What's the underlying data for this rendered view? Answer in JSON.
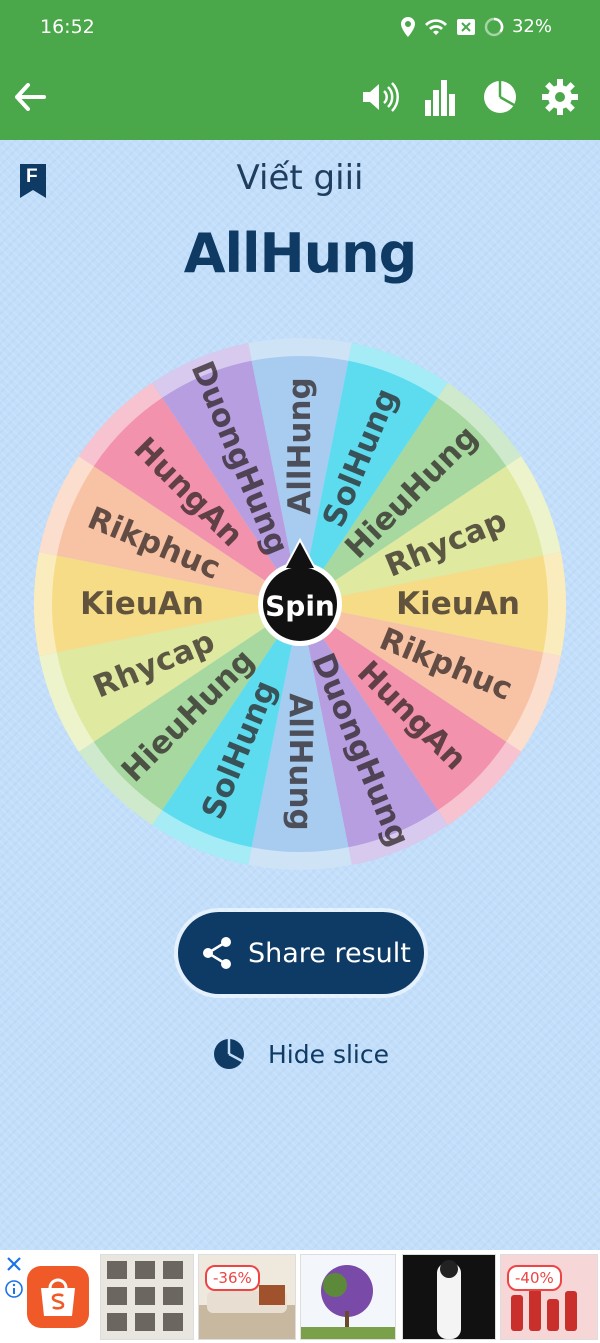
{
  "status_bar": {
    "time": "16:52",
    "battery": "32%"
  },
  "app_bar": {
    "back": "arrow-left-icon",
    "actions": [
      "speaker-icon",
      "bar-chart-icon",
      "pie-chart-icon",
      "gear-icon"
    ]
  },
  "header": {
    "subtitle": "Viết giii",
    "result": "AllHung",
    "bookmark_letter": "F"
  },
  "wheel": {
    "center_label": "Spin",
    "slices": [
      {
        "label": "AllHung",
        "color": "#a8ccf0"
      },
      {
        "label": "SolHung",
        "color": "#5ddcf0"
      },
      {
        "label": "HieuHung",
        "color": "#a6d8a0"
      },
      {
        "label": "Rhycap",
        "color": "#dfe9a0"
      },
      {
        "label": "KieuAn",
        "color": "#f7dc88"
      },
      {
        "label": "Rikphuc",
        "color": "#f8c3a4"
      },
      {
        "label": "HungAn",
        "color": "#f292ac"
      },
      {
        "label": "DuongHung",
        "color": "#b79ee0"
      },
      {
        "label": "AllHung",
        "color": "#a8ccf0"
      },
      {
        "label": "SolHung",
        "color": "#5ddcf0"
      },
      {
        "label": "HieuHung",
        "color": "#a6d8a0"
      },
      {
        "label": "Rhycap",
        "color": "#dfe9a0"
      },
      {
        "label": "KieuAn",
        "color": "#f7dc88"
      },
      {
        "label": "Rikphuc",
        "color": "#f8c3a4"
      },
      {
        "label": "HungAn",
        "color": "#f292ac"
      },
      {
        "label": "DuongHung",
        "color": "#b79ee0"
      }
    ]
  },
  "actions": {
    "share_label": "Share result",
    "hide_label": "Hide slice"
  },
  "ad": {
    "discounts": [
      "-36%",
      "-40%"
    ]
  },
  "colors": {
    "accent": "#4aa84a",
    "primary_dark": "#0e3a66",
    "background": "#c2defa"
  }
}
